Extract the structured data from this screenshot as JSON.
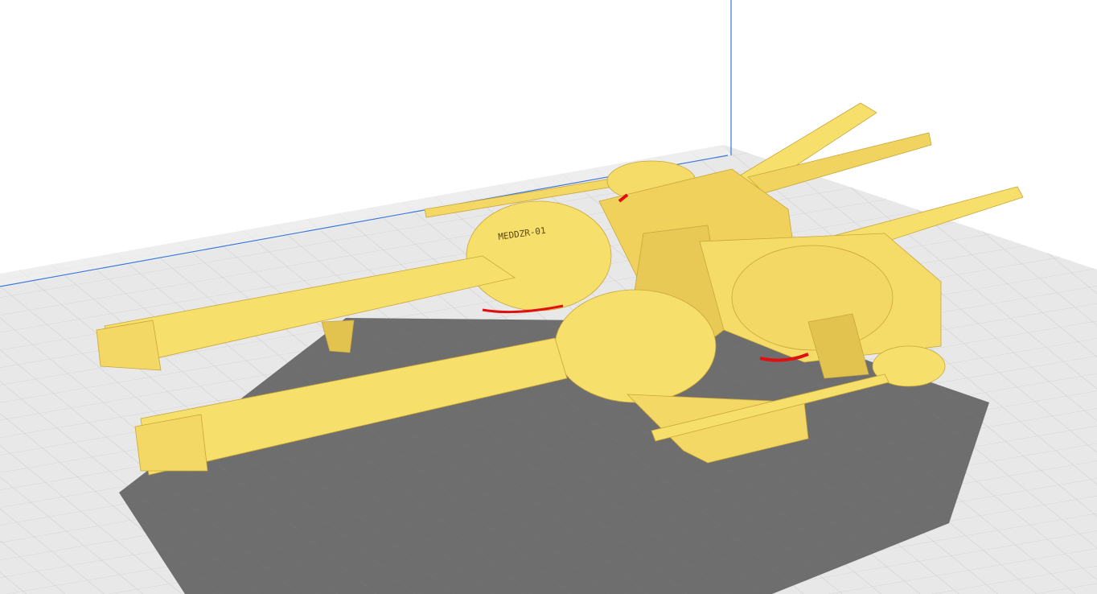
{
  "viewport": {
    "background_color": "#ffffff",
    "plate_color": "#e6e6e6",
    "grid_color": "#c8c8c8",
    "shadow_color": "#6e6e6e",
    "axis_color": "#3a78d8",
    "model_color": "#f7df6c",
    "model_shade_color": "#e2c350",
    "overhang_color": "#e01010"
  },
  "model": {
    "engraved_label": "MEDDZR-01"
  }
}
